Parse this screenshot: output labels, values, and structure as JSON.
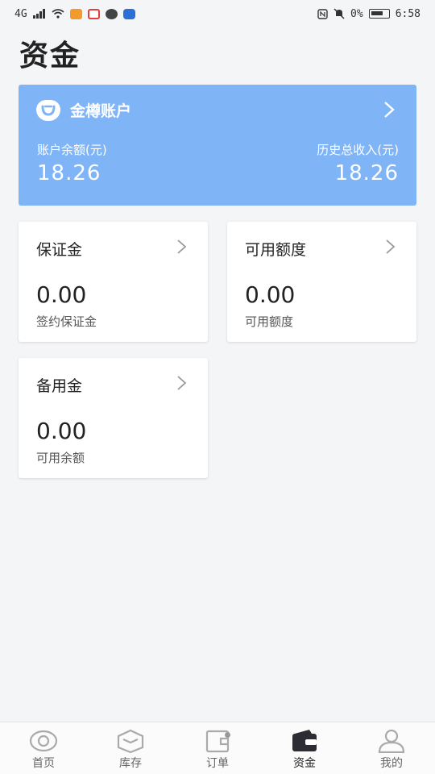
{
  "status_bar": {
    "left_text": "4G",
    "time": "6:58",
    "battery": "0%"
  },
  "page": {
    "title": "资金"
  },
  "account_card": {
    "name": "金樽账户",
    "balance_label": "账户余额(元)",
    "balance_value": "18.26",
    "income_label": "历史总收入(元)",
    "income_value": "18.26",
    "background_color": "#7fb5f7"
  },
  "cards": [
    {
      "title": "保证金",
      "value": "0.00",
      "subtitle": "签约保证金"
    },
    {
      "title": "可用额度",
      "value": "0.00",
      "subtitle": "可用额度"
    },
    {
      "title": "备用金",
      "value": "0.00",
      "subtitle": "可用余额"
    }
  ],
  "tabbar": {
    "items": [
      {
        "label": "首页",
        "icon": "eye-icon",
        "active": false
      },
      {
        "label": "库存",
        "icon": "box-icon",
        "active": false
      },
      {
        "label": "订单",
        "icon": "wallet-outline-icon",
        "active": false,
        "badge_dot": true
      },
      {
        "label": "资金",
        "icon": "wallet-filled-icon",
        "active": true
      },
      {
        "label": "我的",
        "icon": "user-icon",
        "active": false
      }
    ]
  }
}
